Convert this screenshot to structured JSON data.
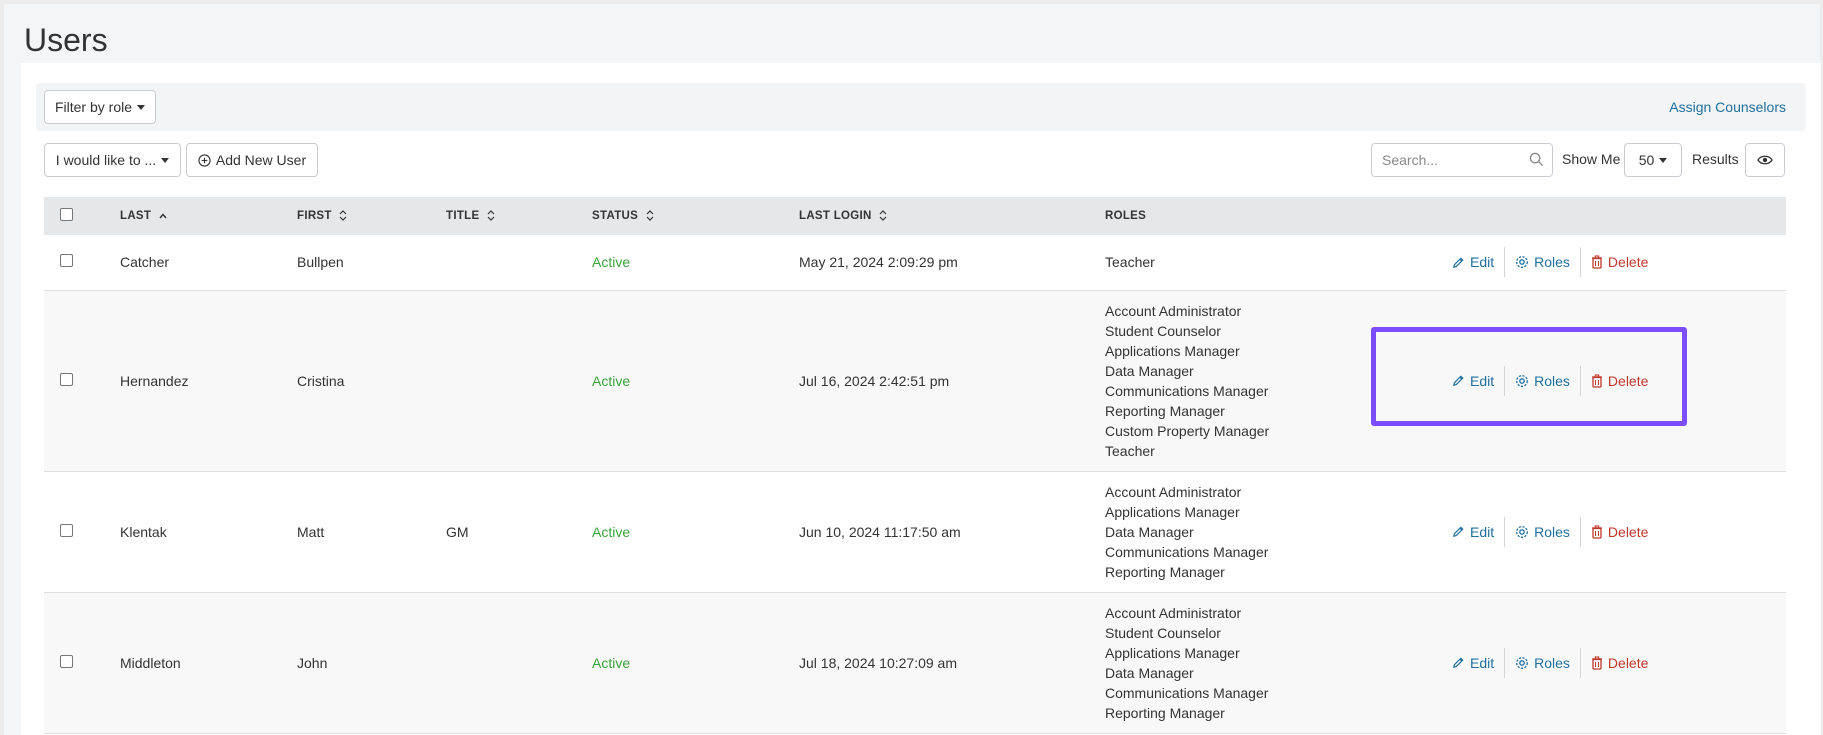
{
  "page": {
    "title": "Users"
  },
  "filter_bar": {
    "filter_button": "Filter by role",
    "assign_link": "Assign Counselors"
  },
  "toolbar": {
    "action_select": "I would like to ...",
    "add_user": "Add New User",
    "search_placeholder": "Search...",
    "show_me_label": "Show Me",
    "page_size": "50",
    "results_label": "Results"
  },
  "table": {
    "headers": {
      "last": "LAST",
      "first": "FIRST",
      "title": "TITLE",
      "status": "STATUS",
      "last_login": "LAST LOGIN",
      "roles": "ROLES"
    },
    "actions": {
      "edit": "Edit",
      "roles": "Roles",
      "delete": "Delete"
    },
    "rows": [
      {
        "last": "Catcher",
        "first": "Bullpen",
        "title": "",
        "status": "Active",
        "last_login": "May 21, 2024 2:09:29 pm",
        "roles": [
          "Teacher"
        ]
      },
      {
        "last": "Hernandez",
        "first": "Cristina",
        "title": "",
        "status": "Active",
        "last_login": "Jul 16, 2024 2:42:51 pm",
        "roles": [
          "Account Administrator",
          "Student Counselor",
          "Applications Manager",
          "Data Manager",
          "Communications Manager",
          "Reporting Manager",
          "Custom Property Manager",
          "Teacher"
        ]
      },
      {
        "last": "Klentak",
        "first": "Matt",
        "title": "GM",
        "status": "Active",
        "last_login": "Jun 10, 2024 11:17:50 am",
        "roles": [
          "Account Administrator",
          "Applications Manager",
          "Data Manager",
          "Communications Manager",
          "Reporting Manager"
        ]
      },
      {
        "last": "Middleton",
        "first": "John",
        "title": "",
        "status": "Active",
        "last_login": "Jul 18, 2024 10:27:09 am",
        "roles": [
          "Account Administrator",
          "Student Counselor",
          "Applications Manager",
          "Data Manager",
          "Communications Manager",
          "Reporting Manager"
        ]
      }
    ]
  },
  "colors": {
    "link": "#1f6f9f",
    "delete": "#c0392b",
    "active_status": "#3aa33a",
    "highlight": "#7c4dff"
  }
}
